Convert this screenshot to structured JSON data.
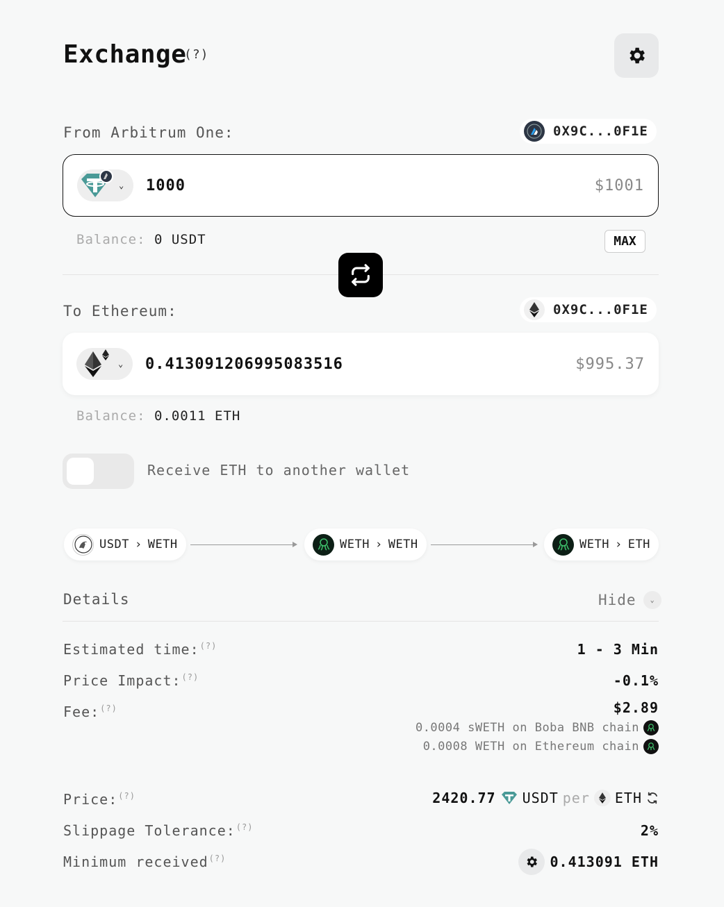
{
  "header": {
    "title": "Exchange",
    "help": "(?)"
  },
  "from": {
    "label": "From Arbitrum One:",
    "wallet": "0X9C...0F1E",
    "amount": "1000",
    "usd": "$1001",
    "balance_label": "Balance:",
    "balance_value": "0 USDT",
    "max_label": "MAX"
  },
  "to": {
    "label": "To Ethereum:",
    "wallet": "0X9C...0F1E",
    "amount": "0.413091206995083516",
    "usd": "$995.37",
    "balance_label": "Balance:",
    "balance_value": "0.0011 ETH"
  },
  "toggle": {
    "label": "Receive ETH to another wallet",
    "on": false
  },
  "route": [
    {
      "from": "USDT",
      "to": "WETH"
    },
    {
      "from": "WETH",
      "to": "WETH"
    },
    {
      "from": "WETH",
      "to": "ETH"
    }
  ],
  "details": {
    "title": "Details",
    "hide_label": "Hide",
    "estimated_time_label": "Estimated time:",
    "estimated_time_value": "1 - 3 Min",
    "price_impact_label": "Price Impact:",
    "price_impact_value": "-0.1%",
    "fee_label": "Fee:",
    "fee_value": "$2.89",
    "fee_line1": "0.0004 sWETH on Boba BNB chain",
    "fee_line2": "0.0008 WETH on Ethereum chain",
    "price_label": "Price:",
    "price_amount": "2420.77",
    "price_base": "USDT",
    "price_per": "per",
    "price_quote": "ETH",
    "slippage_label": "Slippage Tolerance:",
    "slippage_value": "2%",
    "min_received_label": "Minimum received",
    "min_received_value": "0.413091 ETH",
    "help": "(?)"
  },
  "colors": {
    "tether": "#4a9a97",
    "accent": "#000000",
    "background": "#f7f8f8"
  }
}
